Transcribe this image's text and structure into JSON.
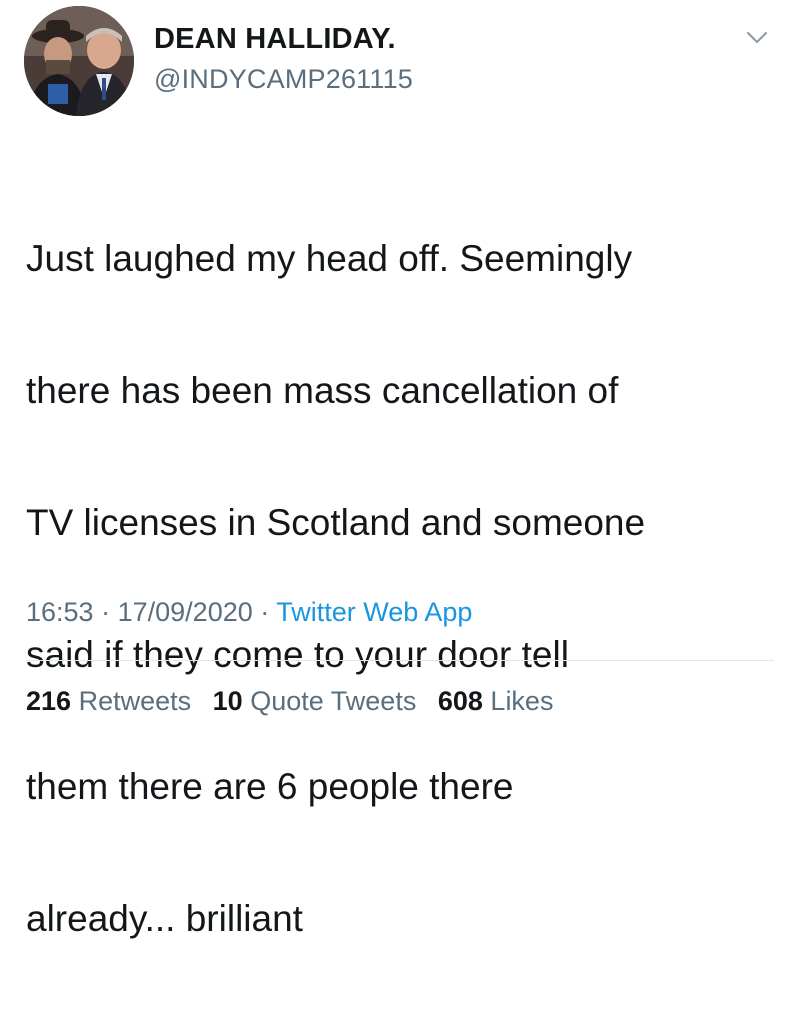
{
  "tweet": {
    "author": {
      "display_name": "DEAN HALLIDAY.",
      "handle": "@INDYCAMP261115"
    },
    "text_lines": [
      "Just laughed my head off. Seemingly",
      "there has been mass cancellation of",
      "TV licenses in Scotland and someone",
      "said if they come to your door tell",
      "them there are 6 people there",
      "already... brilliant"
    ],
    "time": "16:53",
    "date": "17/09/2020",
    "separator": "·",
    "source": "Twitter Web App",
    "stats": {
      "retweets_count": "216",
      "retweets_label": "Retweets",
      "quotes_count": "10",
      "quotes_label": "Quote Tweets",
      "likes_count": "608",
      "likes_label": "Likes"
    },
    "icons": {
      "menu": "chevron-down-icon"
    },
    "colors": {
      "text": "#14171a",
      "secondary": "#5b6e7d",
      "link": "#1b95e0",
      "divider": "#e1e8ed"
    }
  }
}
